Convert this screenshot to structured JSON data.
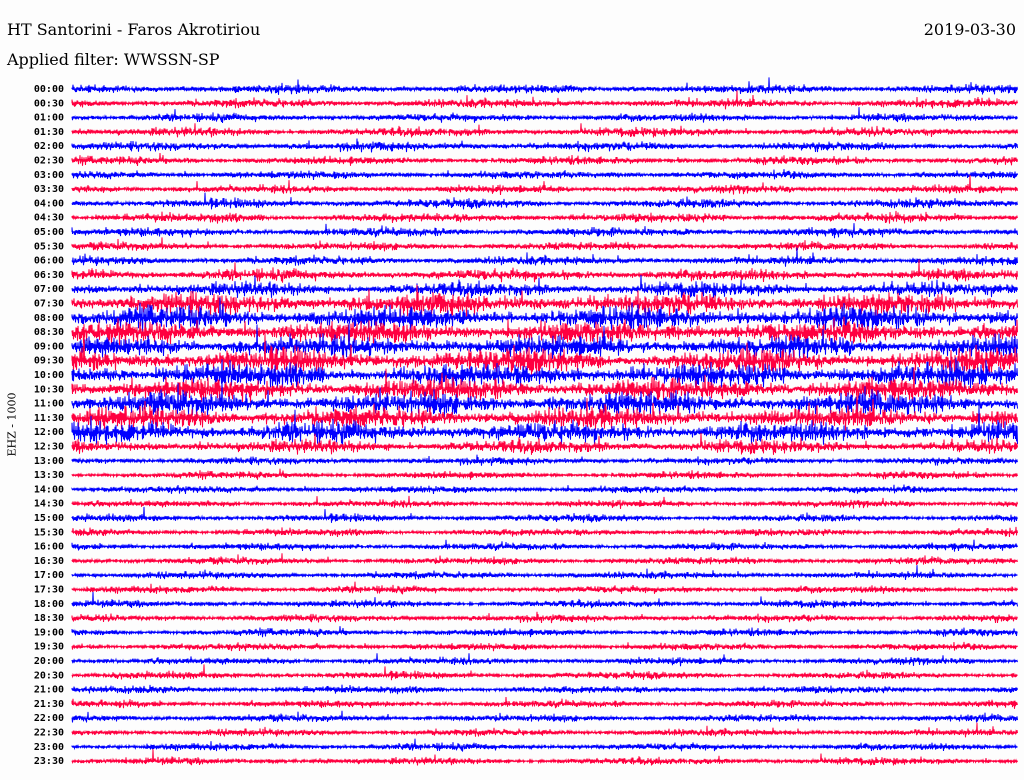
{
  "header": {
    "title": "HT Santorini - Faros Akrotiriou",
    "filter": "Applied filter: WWSSN-SP",
    "date": "2019-03-30"
  },
  "chart_data": {
    "type": "line",
    "title": "HT Santorini - Faros Akrotiriou",
    "subtitle": "Applied filter: WWSSN-SP",
    "date": "2019-03-30",
    "ylabel": "EHZ - 1000",
    "colors": [
      "#0000ff",
      "#ff0040"
    ],
    "row_labels": [
      "00:00",
      "00:30",
      "01:00",
      "01:30",
      "02:00",
      "02:30",
      "03:00",
      "03:30",
      "04:00",
      "04:30",
      "05:00",
      "05:30",
      "06:00",
      "06:30",
      "07:00",
      "07:30",
      "08:00",
      "08:30",
      "09:00",
      "09:30",
      "10:00",
      "10:30",
      "11:00",
      "11:30",
      "12:00",
      "12:30",
      "13:00",
      "13:30",
      "14:00",
      "14:30",
      "15:00",
      "15:30",
      "16:00",
      "16:30",
      "17:00",
      "17:30",
      "18:00",
      "18:30",
      "19:00",
      "19:30",
      "20:00",
      "20:30",
      "21:00",
      "21:30",
      "22:00",
      "22:30",
      "23:00",
      "23:30"
    ],
    "relative_amplitude": [
      1.0,
      1.0,
      0.9,
      1.0,
      1.0,
      0.9,
      0.9,
      0.9,
      1.0,
      1.0,
      1.0,
      0.9,
      1.0,
      1.3,
      1.6,
      2.4,
      2.5,
      2.5,
      2.4,
      2.6,
      2.6,
      2.5,
      2.5,
      2.4,
      2.3,
      1.5,
      0.8,
      0.8,
      0.8,
      0.8,
      0.8,
      0.8,
      0.8,
      0.8,
      0.8,
      0.8,
      0.8,
      0.8,
      0.8,
      0.8,
      0.8,
      0.8,
      0.8,
      0.8,
      0.8,
      0.8,
      0.8,
      0.8
    ]
  }
}
